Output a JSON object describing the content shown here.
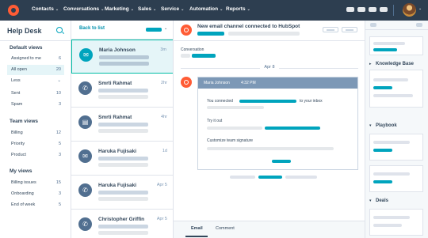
{
  "colors": {
    "nav_bg": "#2d3e50",
    "accent_teal": "#00a4bd",
    "hubspot_orange": "#ff5c35",
    "selected_bg": "#e5f5f8",
    "text": "#33475b"
  },
  "topnav": {
    "logo_icon": "hubspot-sprocket-icon",
    "items": [
      {
        "label": "Contacts"
      },
      {
        "label": "Conversations"
      },
      {
        "label": "Marketing"
      },
      {
        "label": "Sales"
      },
      {
        "label": "Service"
      },
      {
        "label": "Automation"
      },
      {
        "label": "Reports"
      }
    ],
    "chevron": "⌄"
  },
  "sidebar": {
    "title": "Help Desk",
    "search_icon": "search-icon",
    "groups": [
      {
        "label": "Default views",
        "items": [
          {
            "label": "Assigned to me",
            "count": "6"
          },
          {
            "label": "All open",
            "count": "20"
          },
          {
            "label": "Less",
            "count": "⌄"
          },
          {
            "label": "Sent",
            "count": "10"
          },
          {
            "label": "Spam",
            "count": "3"
          }
        ]
      },
      {
        "label": "Team views",
        "items": [
          {
            "label": "Billing",
            "count": "12"
          },
          {
            "label": "Priority",
            "count": "5"
          },
          {
            "label": "Product",
            "count": "3"
          }
        ]
      },
      {
        "label": "My views",
        "items": [
          {
            "label": "Billing issues",
            "count": "15"
          },
          {
            "label": "Onboarding",
            "count": "3"
          },
          {
            "label": "End of week",
            "count": "5"
          }
        ]
      }
    ]
  },
  "ticket_list": {
    "back_label": "Back to list",
    "sort_chevron": "⌄",
    "tickets": [
      {
        "name": "Maria Johnson",
        "time": "3m",
        "icon": "email-icon"
      },
      {
        "name": "Smrti Rahmat",
        "time": "2hr",
        "icon": "phone-icon"
      },
      {
        "name": "Smrti Rahmat",
        "time": "4hr",
        "icon": "document-icon"
      },
      {
        "name": "Haruka Fujisaki",
        "time": "1d",
        "icon": "email-icon"
      },
      {
        "name": "Haruka Fujisaki",
        "time": "Apr 5",
        "icon": "phone-icon"
      },
      {
        "name": "Christopher Griffin",
        "time": "Apr 5",
        "icon": "phone-icon"
      }
    ]
  },
  "conversation": {
    "title": "New email channel connected to HubSpot",
    "label": "Conversation",
    "date_divider": "Apr 8",
    "message": {
      "sender": "Maria Johnson",
      "time": "4:32 PM",
      "line1_prefix": "You connected",
      "line1_suffix": "to your inbox",
      "line2": "Try it out",
      "line3": "Customize team signature"
    },
    "tabs": [
      {
        "label": "Email"
      },
      {
        "label": "Comment"
      }
    ]
  },
  "right_sidebar": {
    "sections": [
      {
        "label": "Knowledge Base",
        "arrow": "▸"
      },
      {
        "label": "Playbook",
        "arrow": "▾"
      },
      {
        "label": "Deals",
        "arrow": "▾"
      }
    ]
  }
}
